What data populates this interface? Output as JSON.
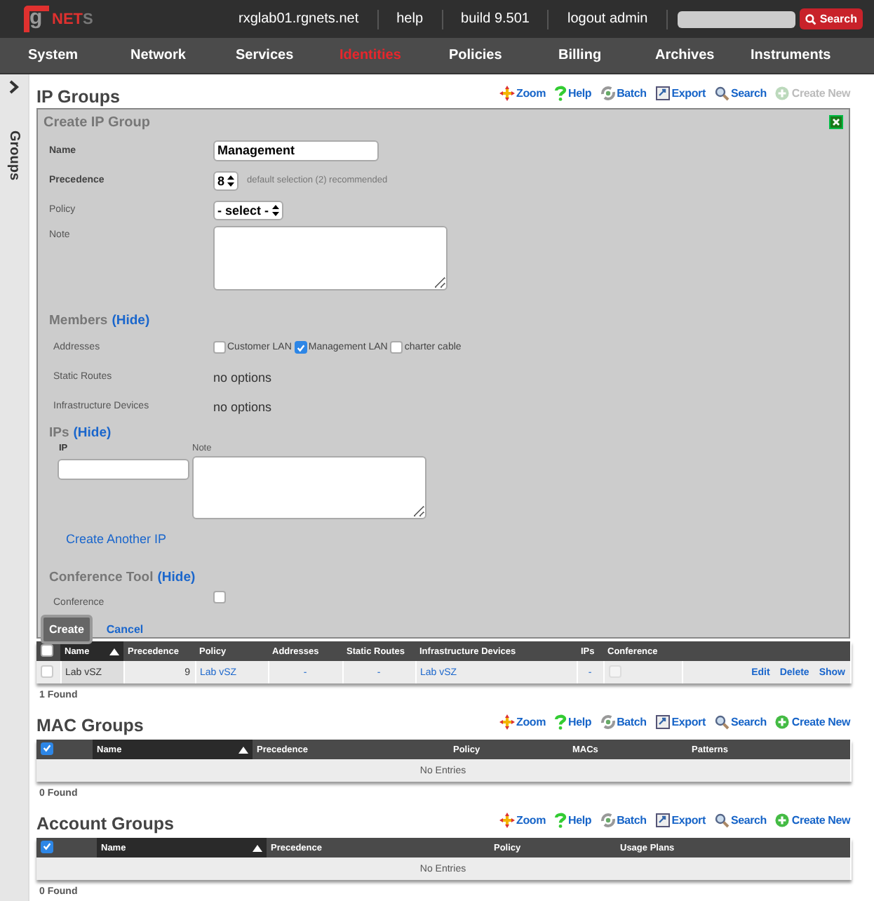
{
  "header": {
    "logo": {
      "mark": "g",
      "name": "NET",
      "tail": "S"
    },
    "links": [
      "rxglab01.rgnets.net",
      "help",
      "build 9.501",
      "logout admin"
    ],
    "search": {
      "button": "Search"
    }
  },
  "nav": [
    {
      "label": "System",
      "selected": false
    },
    {
      "label": "Network",
      "selected": false
    },
    {
      "label": "Services",
      "selected": false
    },
    {
      "label": "Identities",
      "selected": true
    },
    {
      "label": "Policies",
      "selected": false
    },
    {
      "label": "Billing",
      "selected": false
    },
    {
      "label": "Archives",
      "selected": false
    },
    {
      "label": "Instruments",
      "selected": false
    }
  ],
  "sidebar": {
    "label": "Groups"
  },
  "sections": [
    {
      "title": "IP Groups",
      "actions": [
        {
          "kind": "zoom",
          "label": "Zoom",
          "disabled": false
        },
        {
          "kind": "help",
          "label": "Help",
          "disabled": false
        },
        {
          "kind": "batch",
          "label": "Batch",
          "disabled": false
        },
        {
          "kind": "export",
          "label": "Export",
          "disabled": false
        },
        {
          "kind": "search",
          "label": "Search",
          "disabled": false
        },
        {
          "kind": "create",
          "label": "Create New",
          "disabled": true
        }
      ],
      "form": {
        "title": "Create IP Group",
        "name": {
          "label": "Name",
          "value": "Management"
        },
        "precedence": {
          "label": "Precedence",
          "value": "8",
          "hint": "default selection (2) recommended"
        },
        "policy": {
          "label": "Policy",
          "value": "- select -"
        },
        "note": {
          "label": "Note"
        },
        "members": {
          "title": "Members",
          "toggle": "(Hide)",
          "addresses": {
            "label": "Addresses",
            "options": [
              {
                "label": "Customer LAN",
                "checked": false
              },
              {
                "label": "Management LAN",
                "checked": true
              },
              {
                "label": "charter cable",
                "checked": false
              }
            ]
          },
          "static_routes": {
            "label": "Static Routes",
            "value": "no options"
          },
          "infrastructure_devices": {
            "label": "Infrastructure Devices",
            "value": "no options"
          }
        },
        "ips": {
          "title": "IPs",
          "toggle": "(Hide)",
          "ip_label": "IP",
          "note_label": "Note",
          "add_link": "Create Another IP"
        },
        "conference_tool": {
          "title": "Conference Tool",
          "toggle": "(Hide)",
          "label": "Conference",
          "checked": false
        },
        "buttons": {
          "create": "Create",
          "cancel": "Cancel"
        }
      },
      "table": {
        "all_checked": false,
        "columns": [
          {
            "label": "Name",
            "sorted": true
          },
          {
            "label": "Precedence",
            "sorted": false
          },
          {
            "label": "Policy",
            "sorted": false
          },
          {
            "label": "Addresses",
            "sorted": false
          },
          {
            "label": "Static Routes",
            "sorted": false
          },
          {
            "label": "Infrastructure Devices",
            "sorted": false
          },
          {
            "label": "IPs",
            "sorted": false
          },
          {
            "label": "Conference",
            "sorted": false
          }
        ],
        "rows": [
          {
            "checked": false,
            "cells": [
              {
                "kind": "name",
                "text": "Lab vSZ"
              },
              {
                "kind": "number",
                "text": "9"
              },
              {
                "kind": "link",
                "text": "Lab vSZ"
              },
              {
                "kind": "dash",
                "text": "-"
              },
              {
                "kind": "dash",
                "text": "-"
              },
              {
                "kind": "link",
                "text": "Lab vSZ"
              },
              {
                "kind": "dash",
                "text": "-"
              },
              {
                "kind": "checkbox",
                "checked": false
              }
            ],
            "actions": [
              "Edit",
              "Delete",
              "Show"
            ]
          }
        ]
      },
      "found": "1 Found"
    },
    {
      "title": "MAC Groups",
      "actions": [
        {
          "kind": "zoom",
          "label": "Zoom",
          "disabled": false
        },
        {
          "kind": "help",
          "label": "Help",
          "disabled": false
        },
        {
          "kind": "batch",
          "label": "Batch",
          "disabled": false
        },
        {
          "kind": "export",
          "label": "Export",
          "disabled": false
        },
        {
          "kind": "search",
          "label": "Search",
          "disabled": false
        },
        {
          "kind": "create",
          "label": "Create New",
          "disabled": false
        }
      ],
      "table": {
        "all_checked": true,
        "columns": [
          {
            "label": "Name",
            "sorted": true
          },
          {
            "label": "Precedence",
            "sorted": false
          },
          {
            "label": "Policy",
            "sorted": false
          },
          {
            "label": "MACs",
            "sorted": false
          },
          {
            "label": "Patterns",
            "sorted": false
          }
        ],
        "empty": "No Entries"
      },
      "found": "0 Found"
    },
    {
      "title": "Account Groups",
      "actions": [
        {
          "kind": "zoom",
          "label": "Zoom",
          "disabled": false
        },
        {
          "kind": "help",
          "label": "Help",
          "disabled": false
        },
        {
          "kind": "batch",
          "label": "Batch",
          "disabled": false
        },
        {
          "kind": "export",
          "label": "Export",
          "disabled": false
        },
        {
          "kind": "search",
          "label": "Search",
          "disabled": false
        },
        {
          "kind": "create",
          "label": "Create New",
          "disabled": false
        }
      ],
      "table": {
        "all_checked": true,
        "columns": [
          {
            "label": "Name",
            "sorted": true
          },
          {
            "label": "Precedence",
            "sorted": false
          },
          {
            "label": "Policy",
            "sorted": false
          },
          {
            "label": "Usage Plans",
            "sorted": false
          }
        ],
        "empty": "No Entries"
      },
      "found": "0 Found"
    }
  ]
}
